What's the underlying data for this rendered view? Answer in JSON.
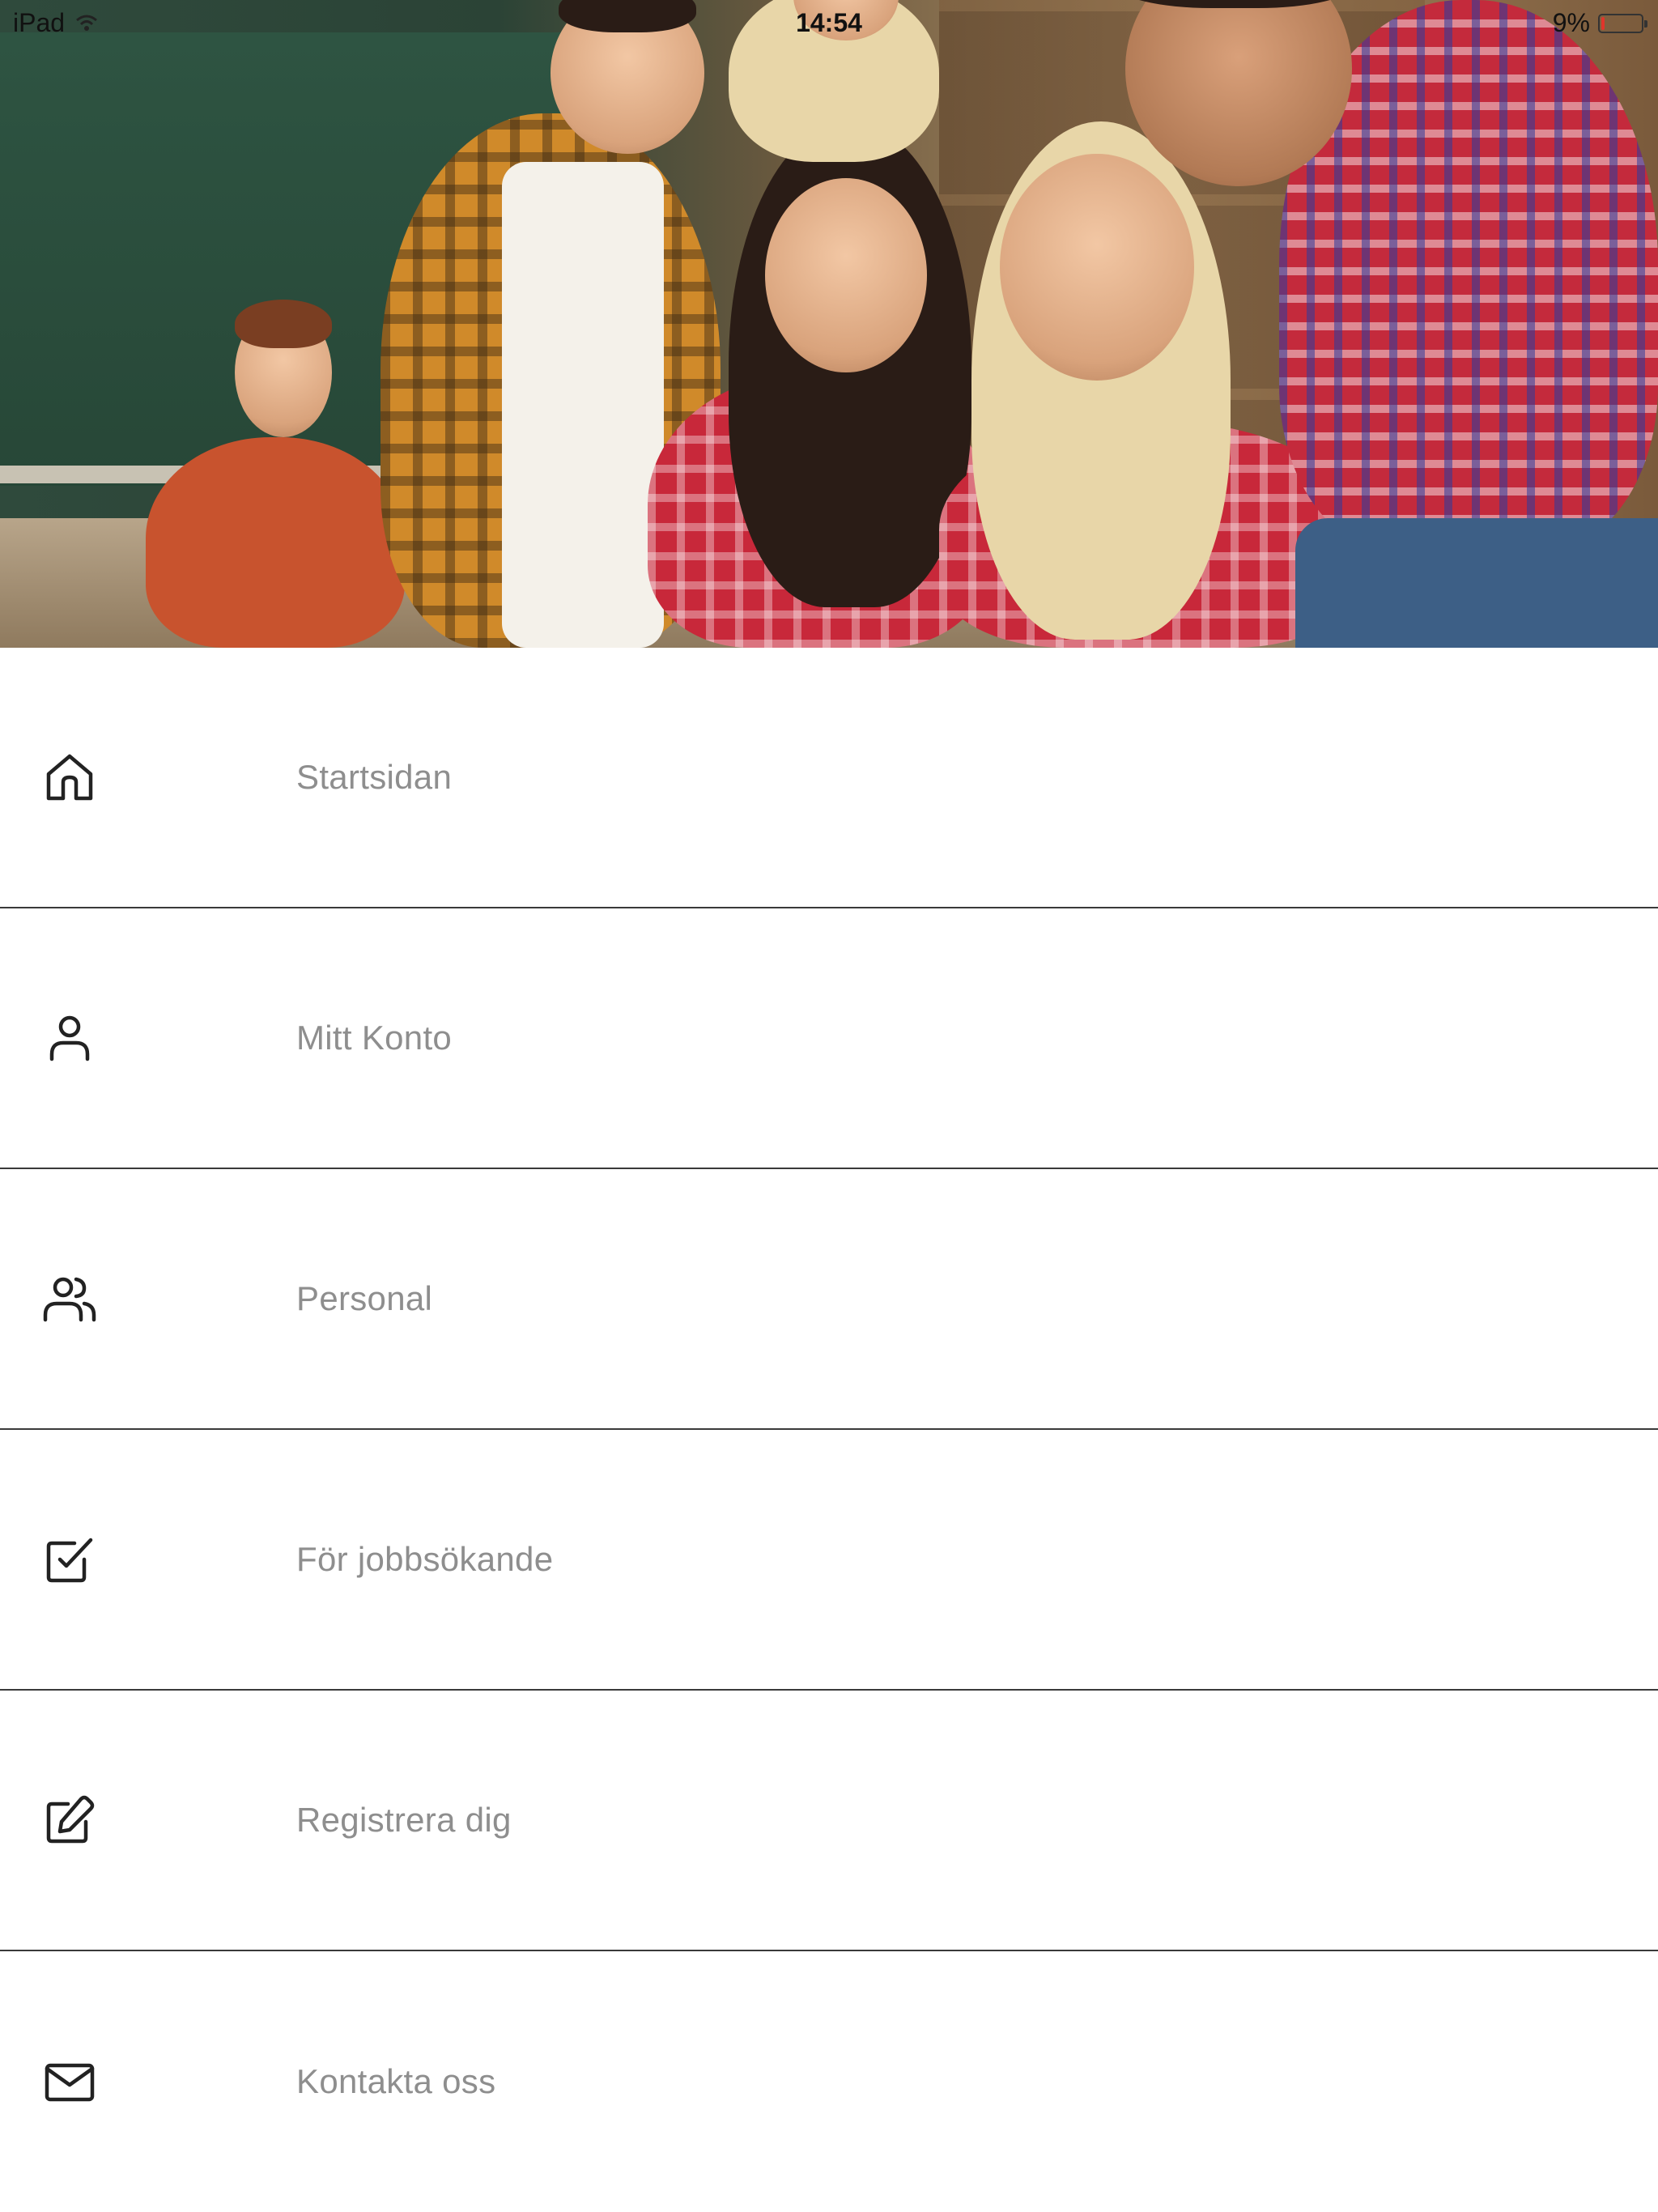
{
  "status_bar": {
    "device": "iPad",
    "time": "14:54",
    "battery_percent": "9%",
    "battery_level": 0.09,
    "wifi_icon": "wifi-icon"
  },
  "hero": {
    "image_alt": "header-photo"
  },
  "menu": {
    "items": [
      {
        "label": "Startsidan",
        "icon": "home-icon"
      },
      {
        "label": "Mitt Konto",
        "icon": "user-icon"
      },
      {
        "label": "Personal",
        "icon": "users-icon"
      },
      {
        "label": "För jobbsökande",
        "icon": "checkbox-icon"
      },
      {
        "label": "Registrera dig",
        "icon": "edit-icon"
      },
      {
        "label": "Kontakta oss",
        "icon": "mail-icon"
      }
    ]
  },
  "colors": {
    "menu_label": "#8e8e8e",
    "divider": "#3a3a3a",
    "icon_stroke": "#222222",
    "battery_low": "#e0352b"
  }
}
